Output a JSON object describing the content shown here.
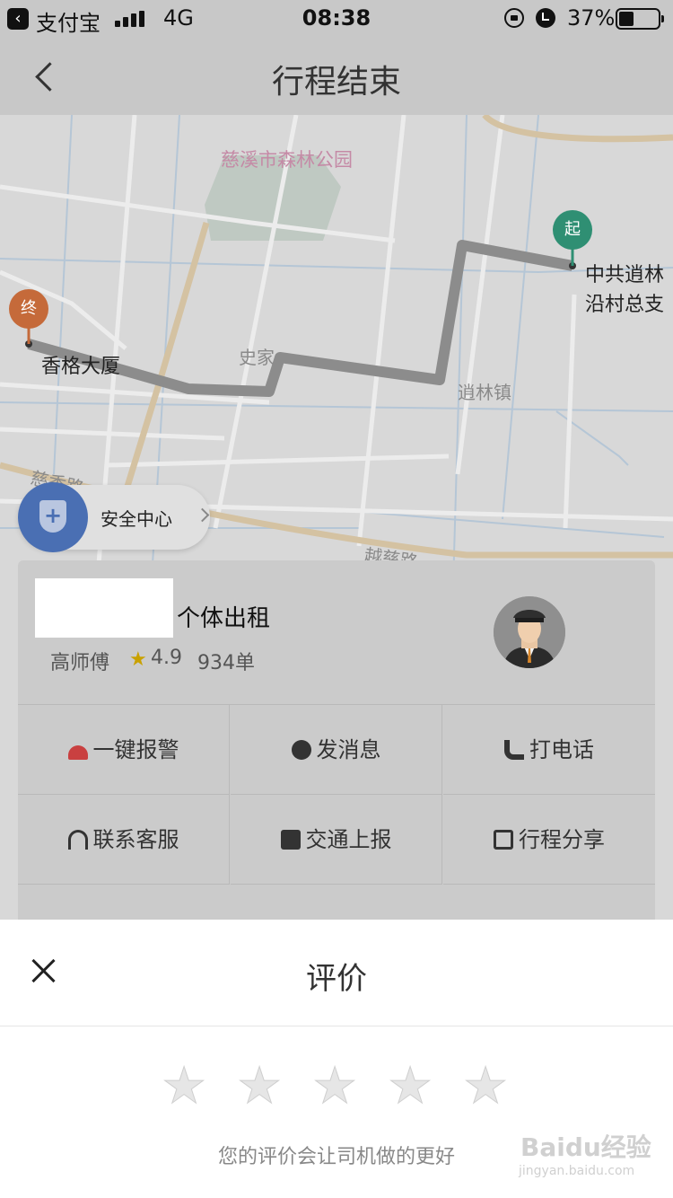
{
  "status_bar": {
    "app_name": "支付宝",
    "network": "4G",
    "time": "08:38",
    "battery_percent": "37%",
    "battery_level": 0.37
  },
  "nav": {
    "title": "行程结束"
  },
  "map": {
    "labels": {
      "park": "慈溪市森林公园",
      "village": "史家",
      "town": "逍林镇",
      "road_1": "慈香路",
      "road_2": "越慈路"
    },
    "start_pin": "起",
    "end_pin": "终",
    "start_name_line1": "中共逍林",
    "start_name_line2": "沿村总支",
    "end_name": "香格大厦"
  },
  "safety": {
    "label": "安全中心"
  },
  "driver": {
    "car_type": "个体出租",
    "name": "高师傅",
    "rating": "4.9",
    "orders": "934单"
  },
  "actions": [
    {
      "label": "一键报警",
      "icon": "alarm-light-icon"
    },
    {
      "label": "发消息",
      "icon": "message-icon"
    },
    {
      "label": "打电话",
      "icon": "phone-icon"
    },
    {
      "label": "联系客服",
      "icon": "headset-icon"
    },
    {
      "label": "交通上报",
      "icon": "report-icon"
    },
    {
      "label": "行程分享",
      "icon": "share-icon"
    }
  ],
  "rating_sheet": {
    "title": "评价",
    "star_count": 5,
    "hint": "您的评价会让司机做的更好"
  },
  "watermark": {
    "brand": "Baidu经验",
    "url": "jingyan.baidu.com"
  },
  "colors": {
    "start_pin": "#2f8f73",
    "end_pin": "#c56a3a",
    "safety_accent": "#4a6fb3",
    "route": "#8c8c8c"
  }
}
